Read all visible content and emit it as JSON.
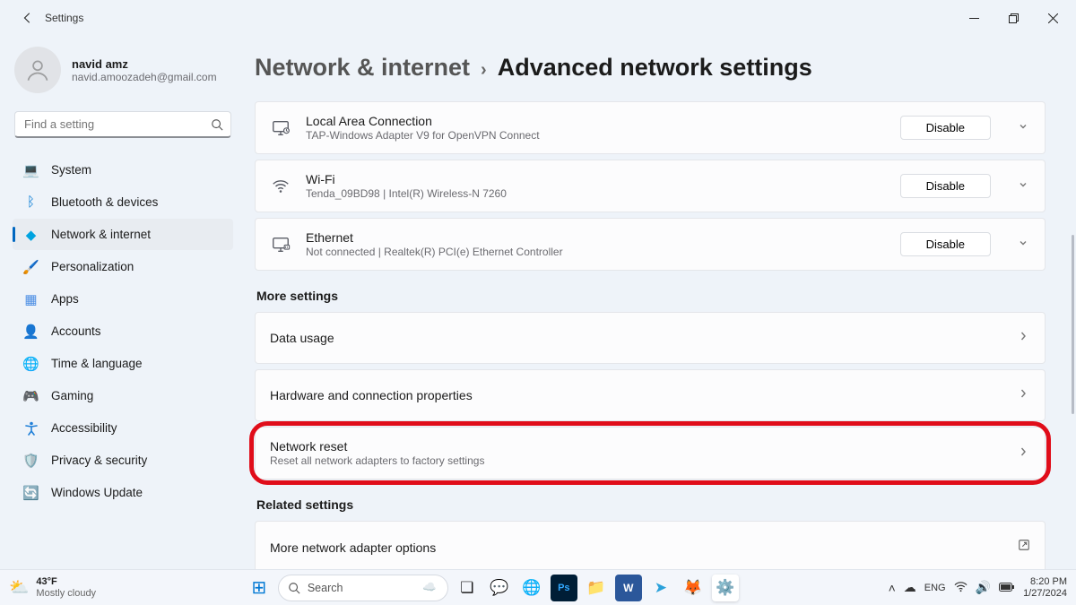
{
  "titlebar": {
    "title": "Settings"
  },
  "profile": {
    "name": "navid amz",
    "email": "navid.amoozadeh@gmail.com"
  },
  "search": {
    "placeholder": "Find a setting"
  },
  "sidebar": [
    {
      "label": "System",
      "icon": "💻"
    },
    {
      "label": "Bluetooth & devices",
      "icon": "ᛒ",
      "color": "#0078d4"
    },
    {
      "label": "Network & internet",
      "icon": "◆",
      "color": "#00a3e0",
      "selected": true
    },
    {
      "label": "Personalization",
      "icon": "🖌️"
    },
    {
      "label": "Apps",
      "icon": "▦",
      "color": "#4a8de4"
    },
    {
      "label": "Accounts",
      "icon": "👤",
      "color": "#3fae57"
    },
    {
      "label": "Time & language",
      "icon": "🌐",
      "color": "#2f9ad4"
    },
    {
      "label": "Gaming",
      "icon": "🎮"
    },
    {
      "label": "Accessibility",
      "icon": "✖",
      "color": "#1f7fd8",
      "accessibility": true
    },
    {
      "label": "Privacy & security",
      "icon": "🛡️"
    },
    {
      "label": "Windows Update",
      "icon": "🔄",
      "color": "#1f7fd8"
    }
  ],
  "breadcrumb": {
    "parent": "Network & internet",
    "current": "Advanced network settings"
  },
  "adapters": [
    {
      "icon": "monitor",
      "title": "Local Area Connection",
      "sub": "TAP-Windows Adapter V9 for OpenVPN Connect",
      "btn": "Disable"
    },
    {
      "icon": "wifi",
      "title": "Wi-Fi",
      "sub": "Tenda_09BD98 | Intel(R) Wireless-N 7260",
      "btn": "Disable"
    },
    {
      "icon": "ethernet",
      "title": "Ethernet",
      "sub": "Not connected | Realtek(R) PCI(e) Ethernet Controller",
      "btn": "Disable"
    }
  ],
  "more_heading": "More settings",
  "more": [
    {
      "title": "Data usage"
    },
    {
      "title": "Hardware and connection properties"
    },
    {
      "title": "Network reset",
      "sub": "Reset all network adapters to factory settings",
      "highlighted": true
    }
  ],
  "related_heading": "Related settings",
  "related": [
    {
      "title": "More network adapter options",
      "ext": true
    }
  ],
  "taskbar": {
    "weather": {
      "temp": "43°F",
      "cond": "Mostly cloudy"
    },
    "search": "Search",
    "lang": "ENG",
    "time": "8:20 PM",
    "date": "1/27/2024"
  }
}
